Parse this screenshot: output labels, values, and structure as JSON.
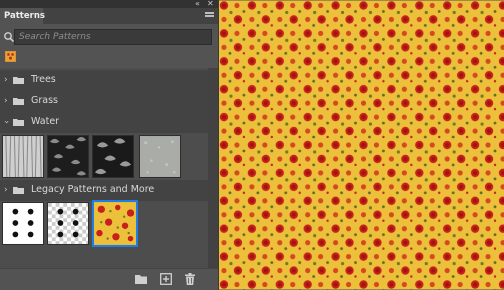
{
  "panel": {
    "title": "Patterns",
    "collapse_glyph": "«",
    "close_glyph": "✕"
  },
  "search": {
    "placeholder": "Search Patterns"
  },
  "groups": [
    {
      "label": "Trees"
    },
    {
      "label": "Grass"
    },
    {
      "label": "Water"
    },
    {
      "label": "Legacy Patterns and More"
    }
  ],
  "chevron": "›",
  "icons": {
    "menu": "hamburger-icon",
    "search": "search-icon",
    "preset": "pattern-preset-icon",
    "folder": "folder-icon",
    "new_group": "new-group-icon",
    "new_pattern": "new-pattern-icon",
    "delete": "trash-icon"
  },
  "colors": {
    "panel_bg": "#535353",
    "list_bg": "#4d4d4d",
    "selection": "#1e7de6",
    "pizza_bg": "#ecc03a",
    "pizza_red": "#c8201c"
  }
}
